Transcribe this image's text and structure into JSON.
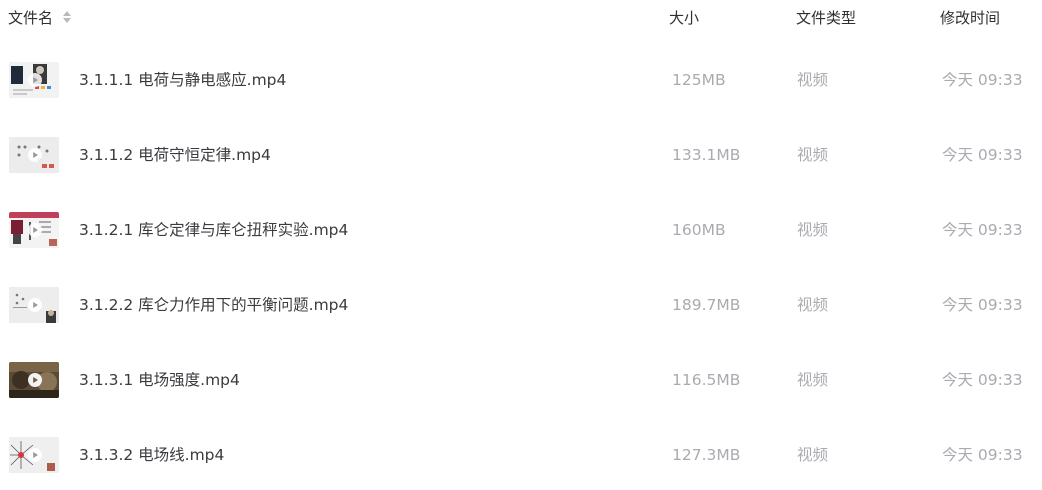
{
  "header": {
    "name_label": "文件名",
    "size_label": "大小",
    "type_label": "文件类型",
    "time_label": "修改时间",
    "sort_icon": "sort-icon"
  },
  "files": [
    {
      "name": "3.1.1.1 电荷与静电感应.mp4",
      "size": "125MB",
      "type": "视频",
      "modified": "今天 09:33",
      "thumb_style": "lecture-dark"
    },
    {
      "name": "3.1.1.2 电荷守恒定律.mp4",
      "size": "133.1MB",
      "type": "视频",
      "modified": "今天 09:33",
      "thumb_style": "light-slide"
    },
    {
      "name": "3.1.2.1 库仑定律与库仑扭秤实验.mp4",
      "size": "160MB",
      "type": "视频",
      "modified": "今天 09:33",
      "thumb_style": "pink-slide"
    },
    {
      "name": "3.1.2.2 库仑力作用下的平衡问题.mp4",
      "size": "189.7MB",
      "type": "视频",
      "modified": "今天 09:33",
      "thumb_style": "light-slide-person"
    },
    {
      "name": "3.1.3.1 电场强度.mp4",
      "size": "116.5MB",
      "type": "视频",
      "modified": "今天 09:33",
      "thumb_style": "dark-photo"
    },
    {
      "name": "3.1.3.2 电场线.mp4",
      "size": "127.3MB",
      "type": "视频",
      "modified": "今天 09:33",
      "thumb_style": "field-lines"
    }
  ],
  "colors": {
    "header_text": "#2f3033",
    "name_text": "#3b3c40",
    "meta_text": "#a9abb0"
  }
}
